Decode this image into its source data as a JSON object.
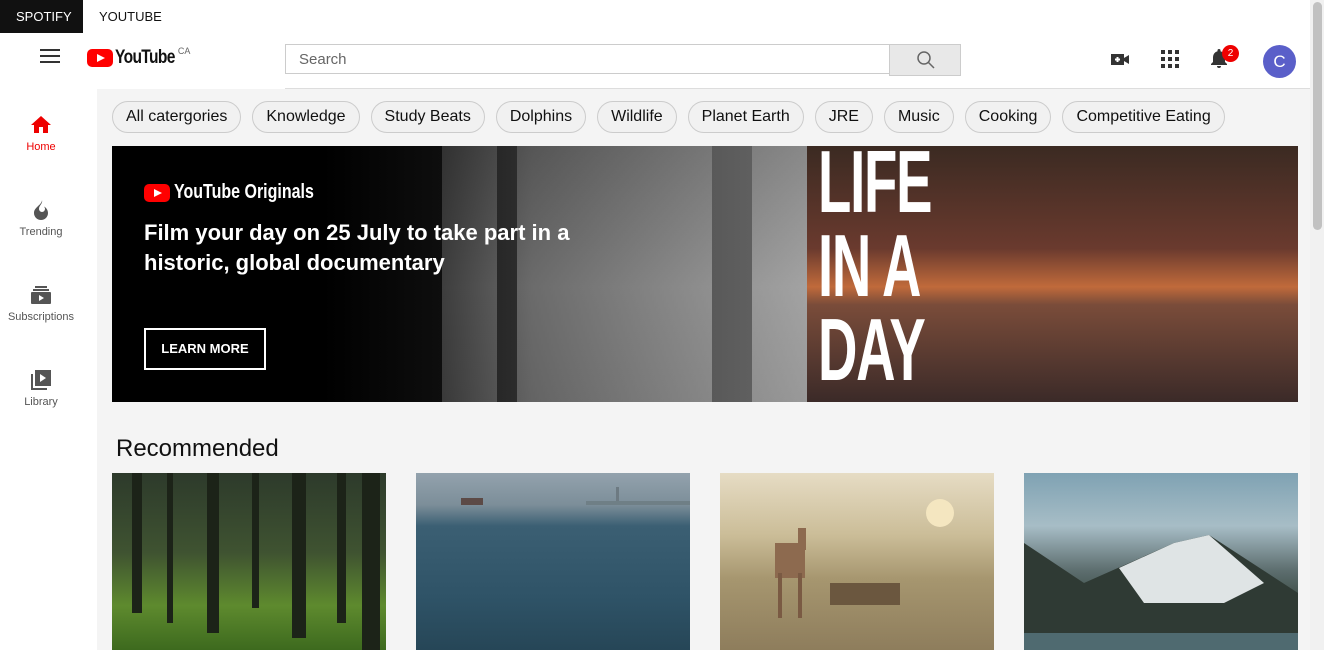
{
  "app_tabs": [
    {
      "label": "SPOTIFY",
      "active": true
    },
    {
      "label": "YOUTUBE",
      "active": false
    }
  ],
  "header": {
    "logo_text": "YouTube",
    "region": "CA",
    "search_placeholder": "Search",
    "notifications_count": "2",
    "avatar_letter": "C",
    "icons": [
      "menu-icon",
      "search-icon",
      "video-camera-icon",
      "apps-grid-icon",
      "bell-icon"
    ]
  },
  "sidebar": {
    "items": [
      {
        "label": "Home",
        "icon": "home-icon",
        "active": true
      },
      {
        "label": "Trending",
        "icon": "flame-icon",
        "active": false
      },
      {
        "label": "Subscriptions",
        "icon": "subscriptions-icon",
        "active": false
      },
      {
        "label": "Library",
        "icon": "library-icon",
        "active": false
      }
    ]
  },
  "chips": [
    "All catergories",
    "Knowledge",
    "Study Beats",
    "Dolphins",
    "Wildlife",
    "Planet Earth",
    "JRE",
    "Music",
    "Cooking",
    "Competitive Eating"
  ],
  "banner": {
    "brand": "YouTube Originals",
    "headline": "Film your day on 25 July to take part in a historic, global documentary",
    "button": "LEARN MORE",
    "title_lines": [
      "LIFE",
      "IN A",
      "DAY"
    ]
  },
  "recommended": {
    "title": "Recommended",
    "thumbnails": [
      "forest",
      "sea",
      "deer",
      "mountain"
    ]
  },
  "colors": {
    "accent": "#ff0000",
    "avatar": "#5a5fc9",
    "content_bg": "#f4f4f4"
  }
}
